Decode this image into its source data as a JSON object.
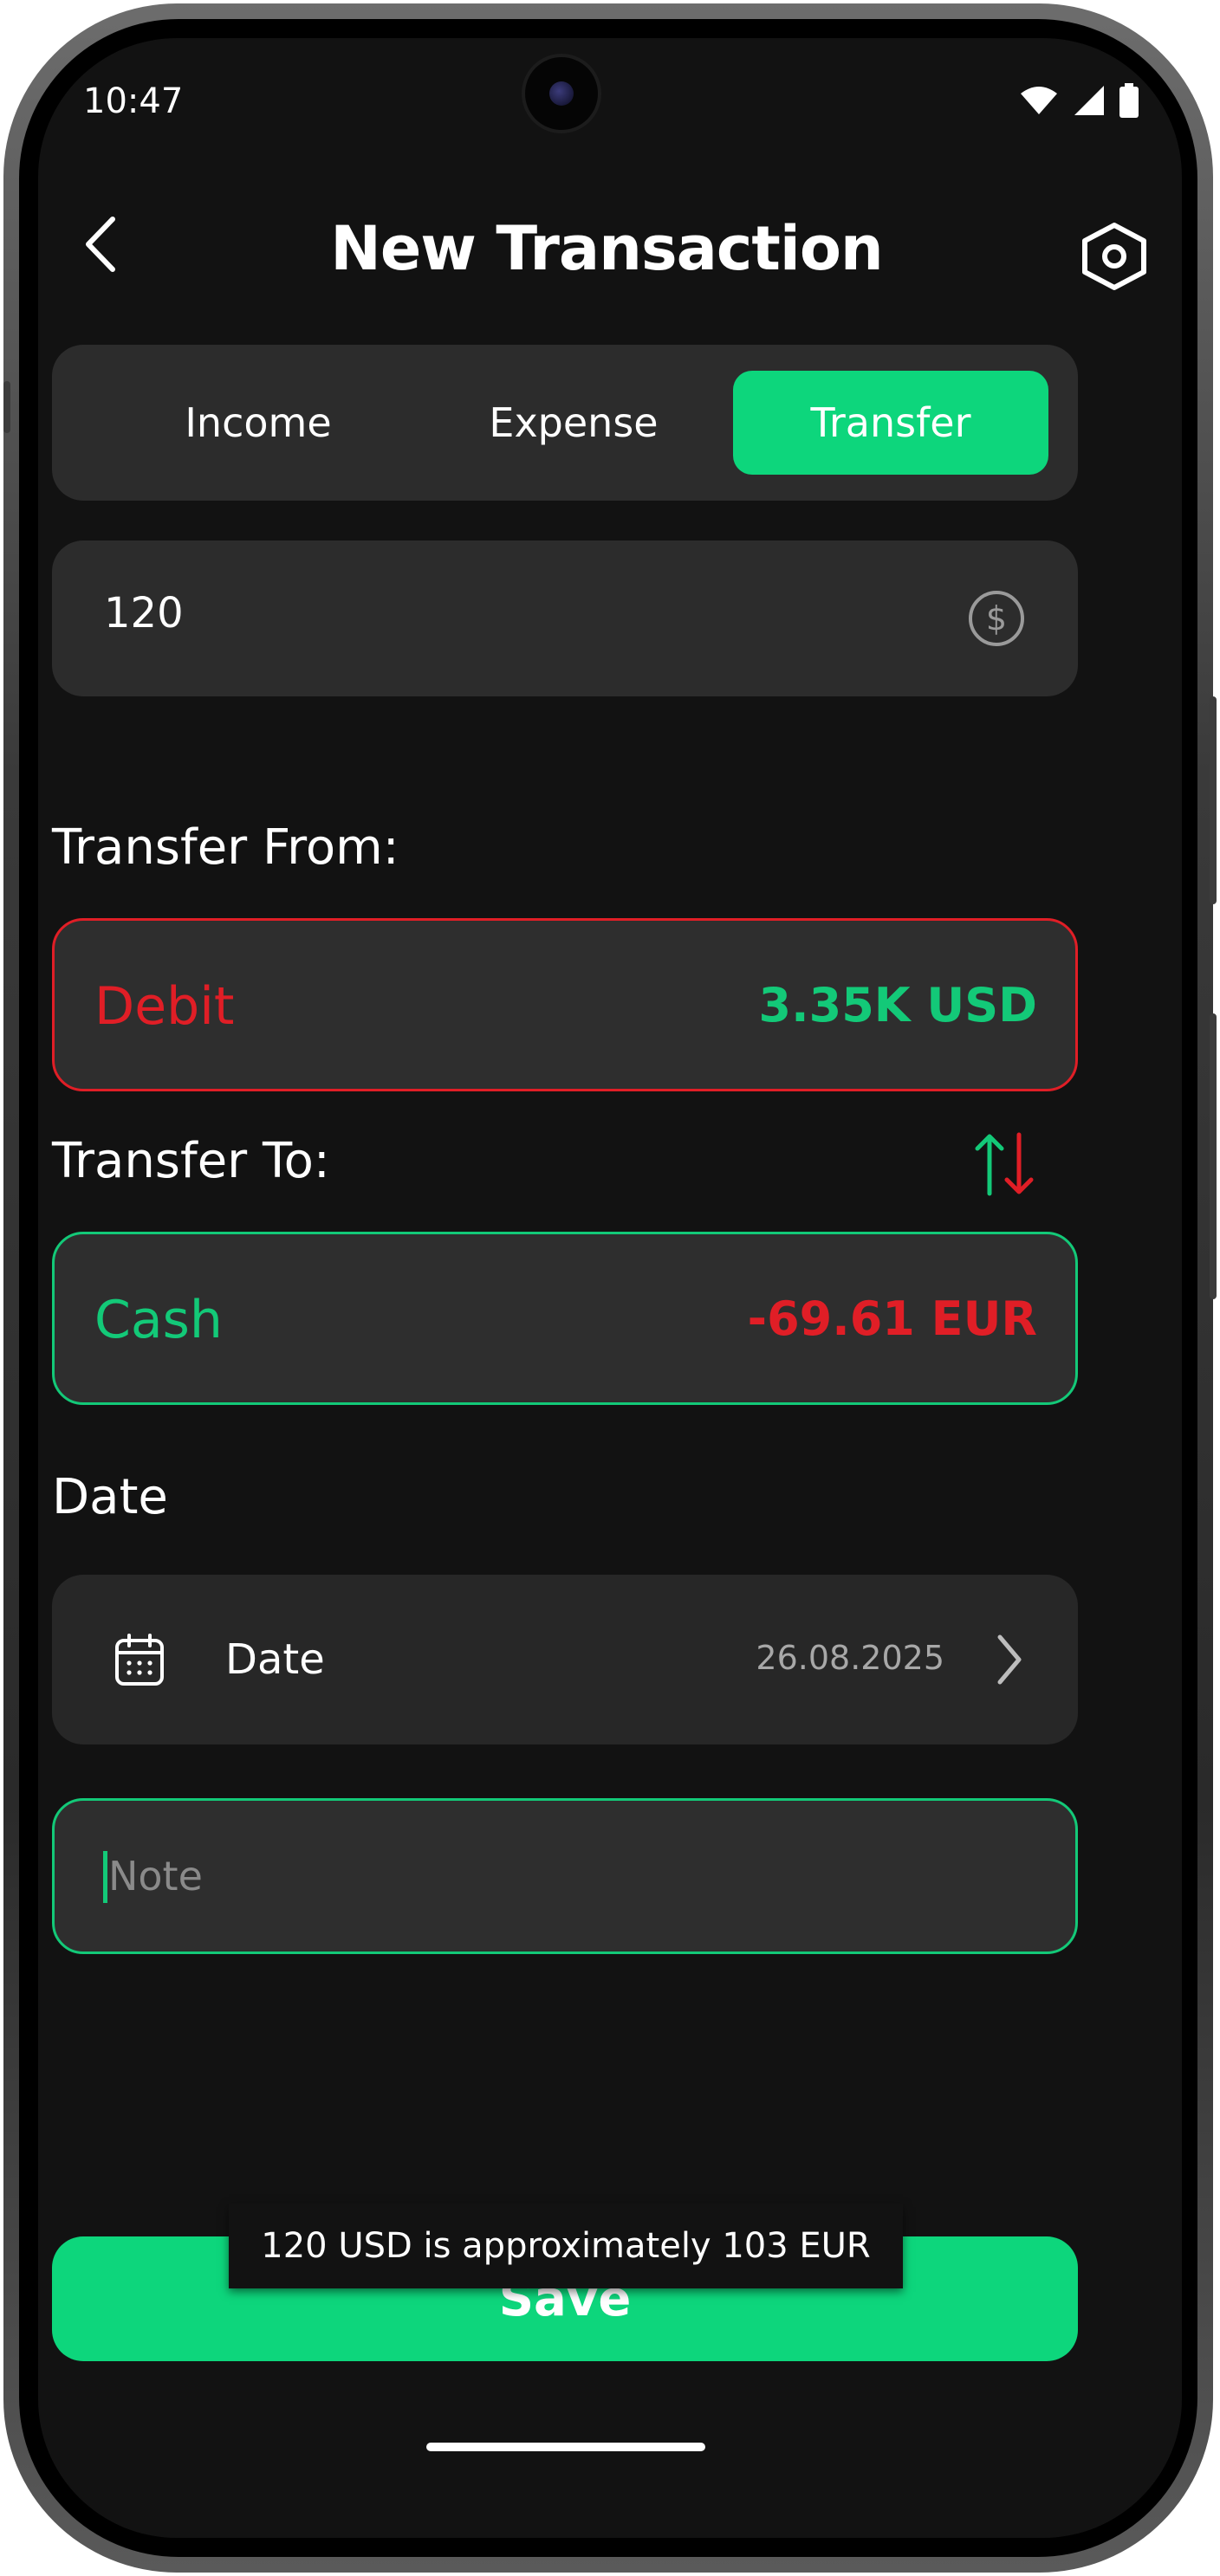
{
  "status": {
    "time": "10:47"
  },
  "header": {
    "title": "New Transaction"
  },
  "tabs": [
    {
      "label": "Income",
      "active": false
    },
    {
      "label": "Expense",
      "active": false
    },
    {
      "label": "Transfer",
      "active": true
    }
  ],
  "amount": {
    "value": "120",
    "icon": "dollar-circle-icon"
  },
  "transfer_from": {
    "label": "Transfer From:",
    "account": "Debit",
    "balance": "3.35K USD",
    "border_color": "#e01e26"
  },
  "transfer_to": {
    "label": "Transfer To:",
    "account": "Cash",
    "balance": "-69.61 EUR",
    "border_color": "#13c978"
  },
  "date_section": {
    "heading": "Date",
    "label": "Date",
    "value": "26.08.2025"
  },
  "note": {
    "placeholder": "Note",
    "value": ""
  },
  "save_label": "Save",
  "toast": {
    "text": "120 USD is approximately 103 EUR"
  },
  "colors": {
    "accent": "#0dd67c",
    "negative": "#e01e26",
    "positive": "#13c978",
    "background": "#121212",
    "card": "#2c2c2c"
  }
}
